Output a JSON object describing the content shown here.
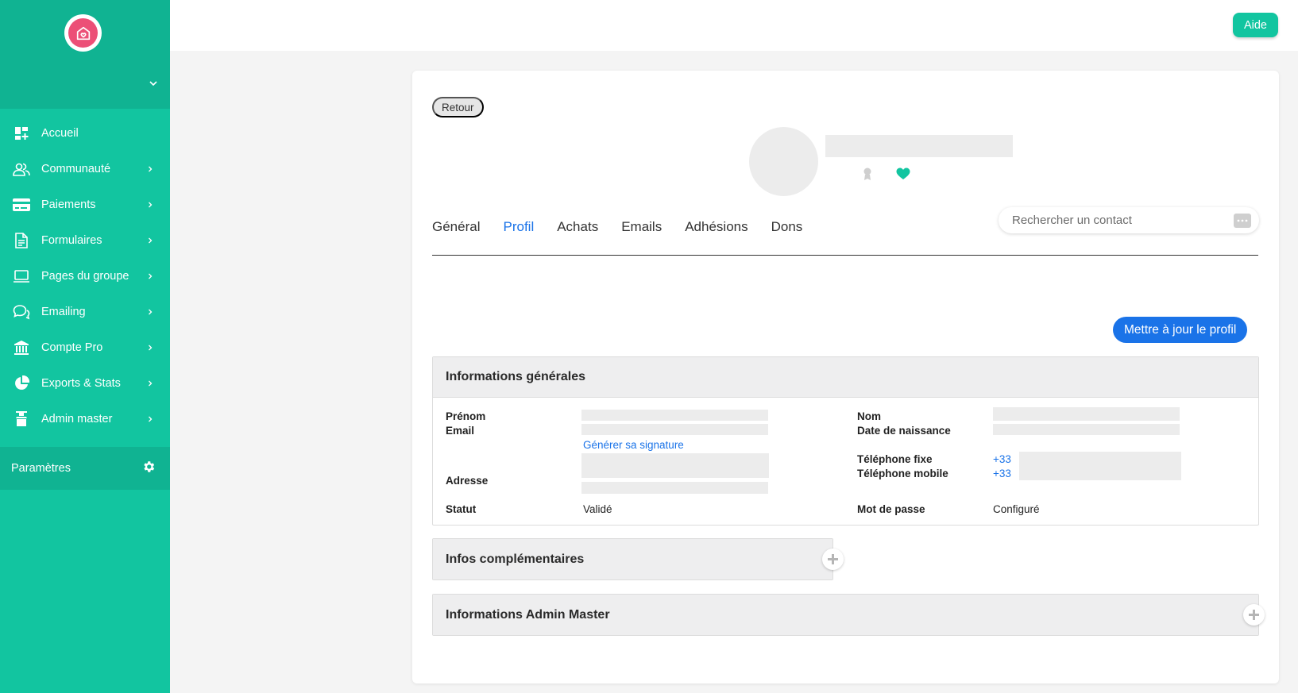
{
  "sidebar": {
    "items": [
      {
        "label": "Accueil",
        "icon": "dashboard-icon",
        "has_arrow": false
      },
      {
        "label": "Communauté",
        "icon": "users-icon",
        "has_arrow": true
      },
      {
        "label": "Paiements",
        "icon": "credit-card-icon",
        "has_arrow": true
      },
      {
        "label": "Formulaires",
        "icon": "document-icon",
        "has_arrow": true
      },
      {
        "label": "Pages du groupe",
        "icon": "laptop-icon",
        "has_arrow": true
      },
      {
        "label": "Emailing",
        "icon": "chat-bubbles-icon",
        "has_arrow": true
      },
      {
        "label": "Compte Pro",
        "icon": "bank-icon",
        "has_arrow": true
      },
      {
        "label": "Exports & Stats",
        "icon": "pie-chart-icon",
        "has_arrow": true
      },
      {
        "label": "Admin master",
        "icon": "admin-icon",
        "has_arrow": true
      }
    ],
    "settings_label": "Paramètres"
  },
  "topbar": {
    "help_label": "Aide"
  },
  "profile": {
    "back_label": "Retour",
    "tabs": [
      "Général",
      "Profil",
      "Achats",
      "Emails",
      "Adhésions",
      "Dons"
    ],
    "active_tab": "Profil",
    "search_placeholder": "Rechercher un contact",
    "update_label": "Mettre à jour le profil"
  },
  "general_info": {
    "title": "Informations générales",
    "labels": {
      "first_name": "Prénom",
      "email": "Email",
      "address": "Adresse",
      "status": "Statut",
      "last_name": "Nom",
      "birth_date": "Date de naissance",
      "phone_fixed": "Téléphone fixe",
      "phone_mobile": "Téléphone mobile",
      "password": "Mot de passe"
    },
    "signature_link": "Générer sa signature",
    "status_value": "Validé",
    "password_value": "Configuré",
    "phone_fixed_prefix": "+33",
    "phone_mobile_prefix": "+33"
  },
  "extra_info": {
    "title": "Infos complémentaires"
  },
  "admin_info": {
    "title": "Informations Admin Master"
  },
  "colors": {
    "brand": "#12c5a0",
    "brand_dark": "#10b392",
    "accent": "#1a73e8",
    "logo": "#ec4f77"
  }
}
